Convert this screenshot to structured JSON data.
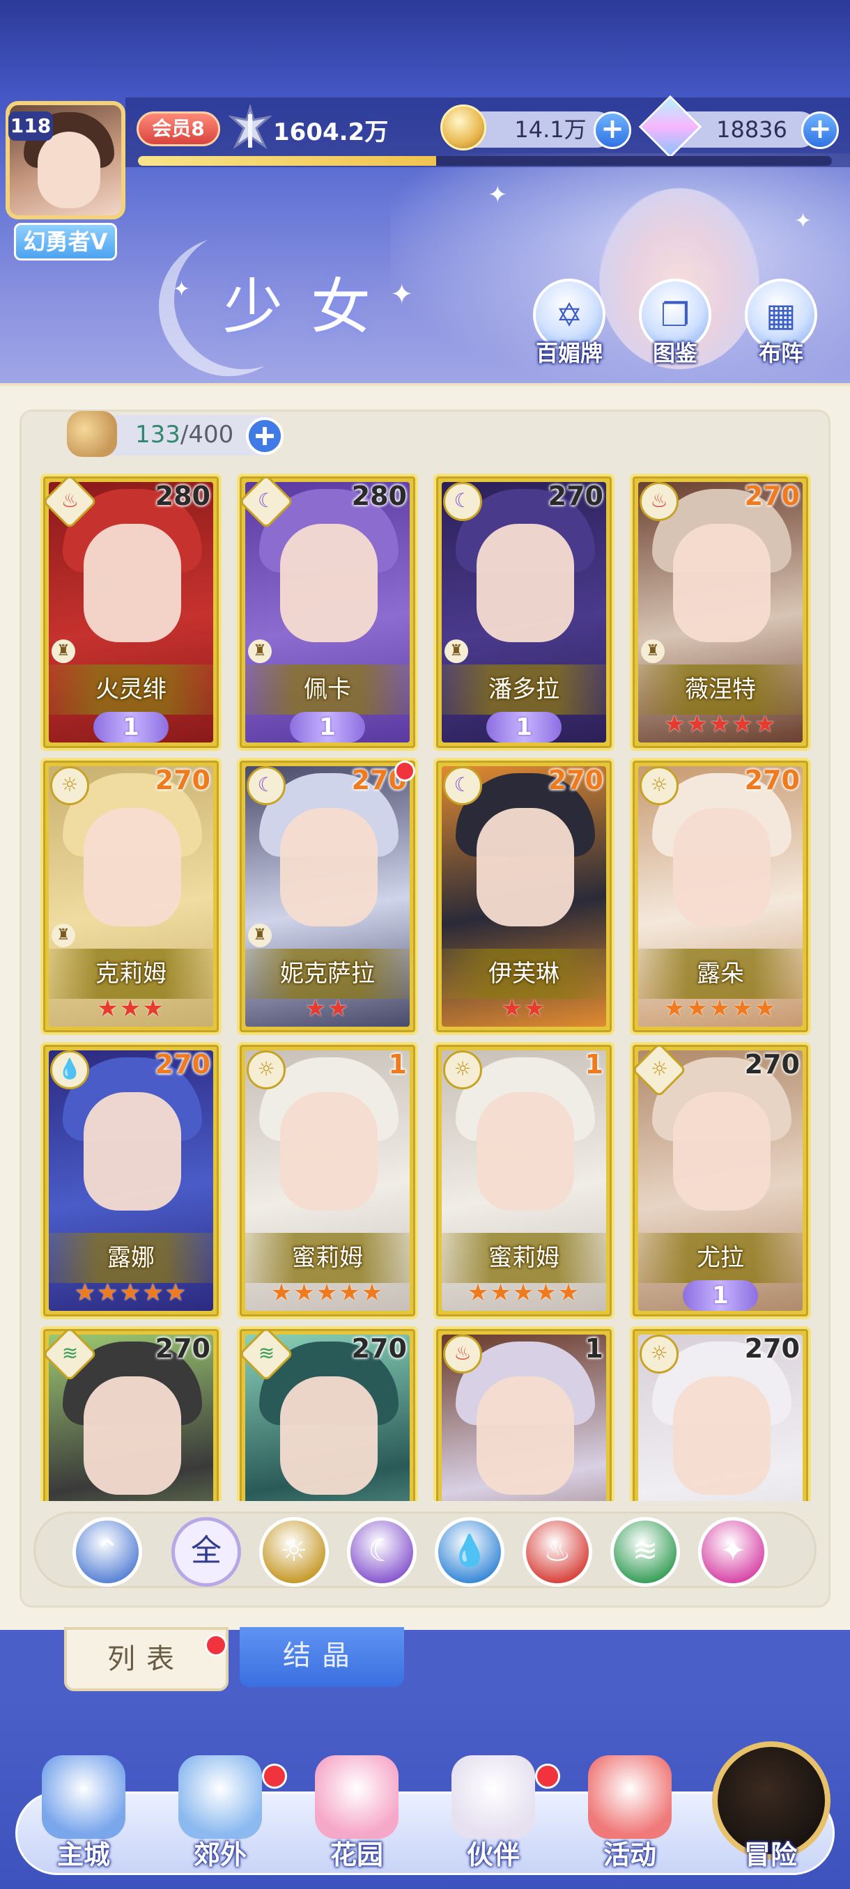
{
  "header": {
    "player": {
      "level": "118",
      "name": "幻勇者V",
      "vip": "会员8"
    },
    "power": "1604.2万",
    "gold": "14.1万",
    "gems": "18836",
    "exp_progress": 0.43,
    "title": "少女",
    "buttons": [
      {
        "label": "百媚牌",
        "icon": "card-deck-icon"
      },
      {
        "label": "图鉴",
        "icon": "book-icon"
      },
      {
        "label": "布阵",
        "icon": "grid-formation-icon"
      }
    ]
  },
  "roster": {
    "count_current": "133",
    "count_max": "/400"
  },
  "cards": [
    {
      "name": "火灵绯",
      "level": "280",
      "element": "fire",
      "frame": "diamond",
      "rank": "wing",
      "rank_value": "1",
      "art": [
        "#c6322e",
        "#8a1a1a"
      ],
      "chess": true
    },
    {
      "name": "佩卡",
      "level": "280",
      "element": "moon",
      "frame": "diamond",
      "rank": "wing",
      "rank_value": "1",
      "art": [
        "#8d6cd0",
        "#5a3aa0"
      ],
      "chess": true
    },
    {
      "name": "潘多拉",
      "level": "270",
      "element": "moon",
      "frame": "circle",
      "rank": "wing",
      "rank_value": "1",
      "art": [
        "#4a3a8c",
        "#2c2058"
      ],
      "chess": true
    },
    {
      "name": "薇涅特",
      "level": "270",
      "element": "fire",
      "frame": "circle",
      "rank": "stars",
      "stars": 5,
      "star_color": "red",
      "art": [
        "#d8c4b4",
        "#6b4030"
      ],
      "chess": true
    },
    {
      "name": "克莉姆",
      "level": "270",
      "element": "sun",
      "frame": "circle",
      "rank": "stars",
      "stars": 3,
      "star_color": "red",
      "art": [
        "#f0dca0",
        "#c8b070"
      ],
      "chess": true
    },
    {
      "name": "妮克萨拉",
      "level": "270",
      "element": "moon",
      "frame": "circle",
      "rank": "stars",
      "stars": 2,
      "star_color": "red",
      "art": [
        "#cfd4ea",
        "#4a4a6a"
      ],
      "chess": true,
      "dot": true
    },
    {
      "name": "伊芙琳",
      "level": "270",
      "element": "moon",
      "frame": "circle",
      "rank": "stars",
      "stars": 2,
      "star_color": "red",
      "art": [
        "#2a2a38",
        "#e08a30"
      ],
      "chess": false
    },
    {
      "name": "露朵",
      "level": "270",
      "element": "sun",
      "frame": "circle",
      "rank": "stars",
      "stars": 5,
      "star_color": "orange",
      "art": [
        "#f4e8dc",
        "#c89a70"
      ],
      "chess": false
    },
    {
      "name": "露娜",
      "level": "270",
      "element": "water",
      "frame": "circle",
      "rank": "stars",
      "stars": 5,
      "star_color": "orange",
      "art": [
        "#4a5cc8",
        "#2c2a80"
      ],
      "chess": false
    },
    {
      "name": "蜜莉姆",
      "level": "1",
      "element": "sun",
      "frame": "circle",
      "rank": "stars",
      "stars": 5,
      "star_color": "orange",
      "art": [
        "#f0ece6",
        "#c8c0b8"
      ],
      "chess": false
    },
    {
      "name": "蜜莉姆",
      "level": "1",
      "element": "sun",
      "frame": "circle",
      "rank": "stars",
      "stars": 5,
      "star_color": "orange",
      "art": [
        "#f0ece6",
        "#c8c0b8"
      ],
      "chess": false
    },
    {
      "name": "尤拉",
      "level": "270",
      "element": "sun",
      "frame": "diamond",
      "rank": "wing",
      "rank_value": "1",
      "art": [
        "#e8d4c4",
        "#b08a6a"
      ],
      "chess": false
    },
    {
      "name": "",
      "level": "270",
      "element": "wind",
      "frame": "diamond",
      "rank": "none",
      "art": [
        "#3a3a3a",
        "#9cc870"
      ],
      "chess": false
    },
    {
      "name": "",
      "level": "270",
      "element": "wind",
      "frame": "diamond",
      "rank": "none",
      "art": [
        "#2a5a58",
        "#8ad0b8"
      ],
      "chess": false
    },
    {
      "name": "",
      "level": "1",
      "element": "fire",
      "frame": "circle",
      "rank": "none",
      "art": [
        "#d8d0e4",
        "#6a3a2a"
      ],
      "chess": false
    },
    {
      "name": "",
      "level": "270",
      "element": "sun",
      "frame": "circle",
      "rank": "none",
      "art": [
        "#f0eef2",
        "#d8cfd8"
      ],
      "chess": false
    }
  ],
  "element_icons": {
    "fire": "fire-element-icon",
    "moon": "moon-element-icon",
    "sun": "sun-element-icon",
    "water": "water-element-icon",
    "wind": "wind-element-icon"
  },
  "filters": [
    {
      "key": "tier",
      "label": "",
      "color": "#5a84d6",
      "glyph": "⌃"
    },
    {
      "key": "all",
      "label": "全",
      "color": "#2f3b8c",
      "glyph": "全"
    },
    {
      "key": "sun",
      "label": "",
      "color": "#c79a2a",
      "glyph": "☼"
    },
    {
      "key": "moon",
      "label": "",
      "color": "#8a5ad0",
      "glyph": "☾"
    },
    {
      "key": "water",
      "label": "",
      "color": "#3a8ad8",
      "glyph": "💧"
    },
    {
      "key": "fire",
      "label": "",
      "color": "#d8443e",
      "glyph": "♨"
    },
    {
      "key": "wind",
      "label": "",
      "color": "#3aa05a",
      "glyph": "≋"
    },
    {
      "key": "star",
      "label": "",
      "color": "#d848a8",
      "glyph": "✦"
    }
  ],
  "tabs": {
    "list": "列表",
    "crystal": "结晶"
  },
  "nav": [
    {
      "label": "主城",
      "icon": "castle-icon"
    },
    {
      "label": "郊外",
      "icon": "portal-icon",
      "dot": true
    },
    {
      "label": "花园",
      "icon": "heart-icon"
    },
    {
      "label": "伙伴",
      "icon": "partner-icon",
      "dot": true,
      "active": true
    },
    {
      "label": "活动",
      "icon": "gift-icon"
    },
    {
      "label": "冒险",
      "icon": "compass-icon"
    }
  ],
  "colors": {
    "card_gold": "#e5c63a",
    "accent_blue": "#3a6fe0",
    "alert_red": "#f0333c",
    "level_orange": "#f07a1e",
    "level_dark": "#2a2a2a"
  }
}
